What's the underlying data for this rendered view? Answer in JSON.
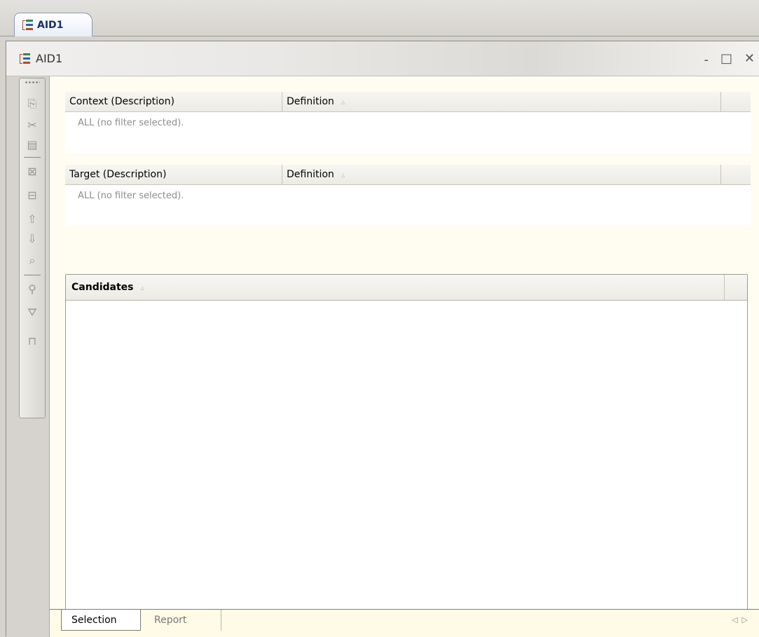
{
  "editor_tab": {
    "label": "AID1"
  },
  "view": {
    "title": "AID1",
    "minimize": "-",
    "maximize": "□",
    "close": "✕"
  },
  "toolbar_icons": [
    "copy-icon",
    "cut-icon",
    "paste-icon",
    "remove-icon",
    "remove-all-icon",
    "move-up-icon",
    "move-down-icon",
    "find-icon",
    "filter-add-icon",
    "filter-icon",
    "link-icon"
  ],
  "context_table": {
    "col1": "Context (Description)",
    "col2": "Definition",
    "empty_text": "ALL (no filter selected)."
  },
  "target_table": {
    "col1": "Target (Description)",
    "col2": "Definition",
    "empty_text": "ALL (no filter selected)."
  },
  "candidates_table": {
    "header": "Candidates"
  },
  "bottom_tabs": [
    {
      "label": "Selection",
      "active": true
    },
    {
      "label": "Report",
      "active": false
    }
  ],
  "colors": {
    "tab_text": "#15306b",
    "panel_bg": "#fffdf2",
    "frame": "#d6d3ce"
  }
}
